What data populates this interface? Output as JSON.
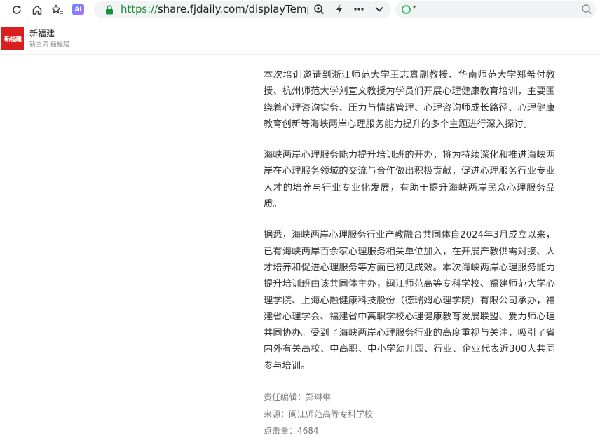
{
  "browser": {
    "url_protocol": "https://",
    "url_rest": "share.fjdaily.com/displayTemplate/ne",
    "ai_badge": "AI",
    "search_placeholder": "",
    "search_engine_caret": "▾"
  },
  "site": {
    "logo_text": "新福建",
    "name": "新福建",
    "slogan": "新主流 最福建"
  },
  "article": {
    "paragraphs": [
      "本次培训邀请到浙江师范大学王志寰副教授、华南师范大学郑希付教授、杭州师范大学刘宣文教授为学员们开展心理健康教育培训，主要围绕着心理咨询实务、压力与情绪管理、心理咨询师成长路径、心理健康教育创新等海峡两岸心理服务能力提升的多个主题进行深入探讨。",
      "海峡两岸心理服务能力提升培训班的开办，将为持续深化和推进海峡两岸在心理服务领域的交流与合作做出积极贡献，促进心理服务行业专业人才的培养与行业专业化发展，有助于提升海峡两岸民众心理服务品质。",
      "据悉，海峡两岸心理服务行业产教融合共同体自2024年3月成立以来，已有海峡两岸百余家心理服务相关单位加入，在开展产教供需对接、人才培养和促进心理服务等方面已初见成效。本次海峡两岸心理服务能力提升培训班由该共同体主办，闽江师范高等专科学校、福建师范大学心理学院、上海心融健康科技股份（德瑞姆心理学院）有限公司承办，福建省心理学会、福建省中高职学校心理健康教育发展联盟、爱力师心理共同协办。受到了海峡两岸心理服务行业的高度重视与关注，吸引了省内外有关高校、中高职、中小学幼儿园、行业、企业代表近300人共同参与培训。"
    ],
    "editor": "责任编辑：郑琳琳",
    "source": "来源：闽江师范高等专科学校",
    "views": "点击量：4684"
  }
}
